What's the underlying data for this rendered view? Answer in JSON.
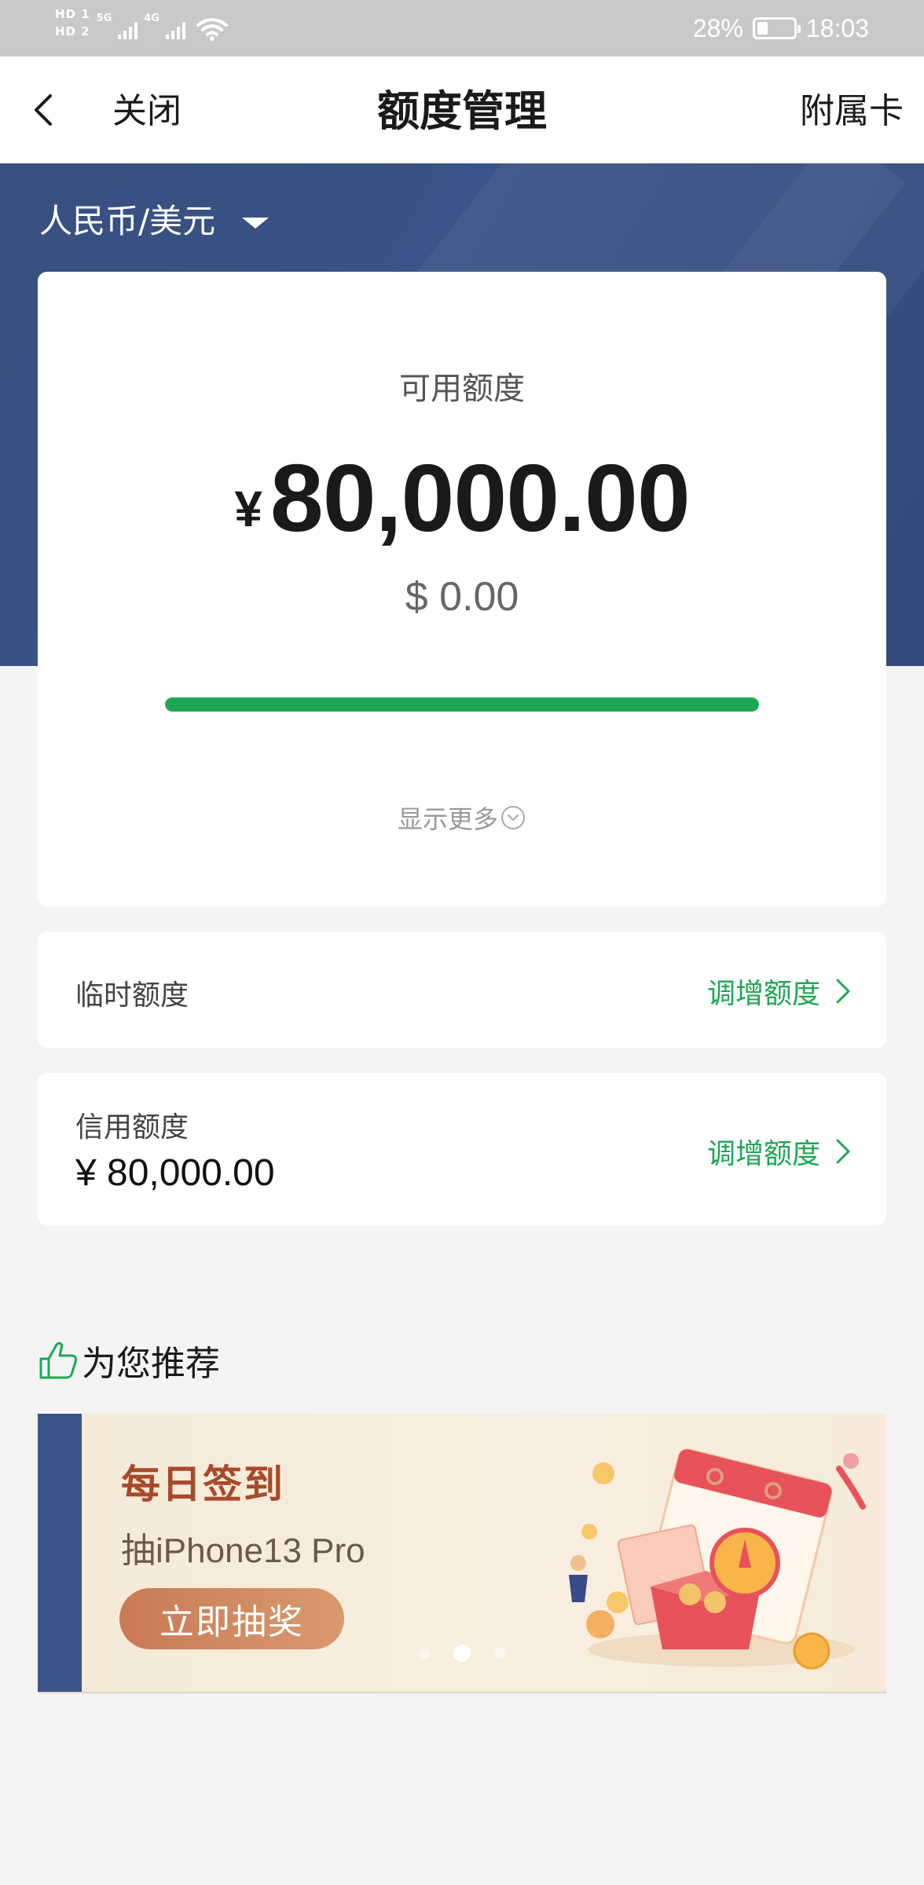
{
  "status_bar": {
    "sim1": "HD 1",
    "sim2": "HD 2",
    "net1": "5G",
    "net2": "4G",
    "battery_pct": "28%",
    "battery_level": 0.28,
    "time": "18:03"
  },
  "nav": {
    "back_icon": "chevron-left-icon",
    "close_label": "关闭",
    "title": "额度管理",
    "right_label": "附属卡"
  },
  "currency_selector": {
    "value": "人民币/美元"
  },
  "limit_card": {
    "label": "可用额度",
    "currency_symbol": "¥",
    "amount": "80,000.00",
    "usd_amount": "$ 0.00",
    "progress": 1.0,
    "show_more": "显示更多"
  },
  "temporary_limit": {
    "label": "临时额度",
    "action": "调增额度"
  },
  "credit_limit": {
    "label": "信用额度",
    "value": "¥ 80,000.00",
    "action": "调增额度"
  },
  "recommend": {
    "title": "为您推荐",
    "icon": "thumbs-up-icon",
    "banner": {
      "title": "每日签到",
      "subtitle": "抽iPhone13 Pro",
      "button": "立即抽奖",
      "active_slide": 2,
      "slide_count": 3
    }
  },
  "colors": {
    "brand_blue": "#3a5388",
    "accent_green": "#1fa655",
    "banner_orange": "#c87a55"
  }
}
